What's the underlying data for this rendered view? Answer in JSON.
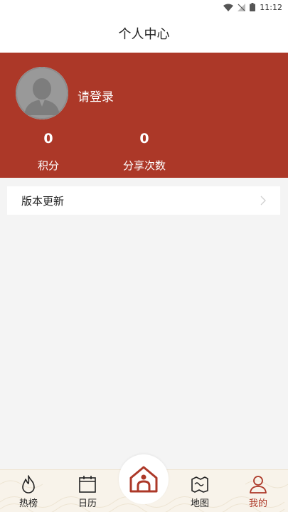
{
  "status_bar": {
    "time": "11:12"
  },
  "header": {
    "title": "个人中心"
  },
  "profile": {
    "login_prompt": "请登录",
    "stats": [
      {
        "value": "0",
        "label": "积分"
      },
      {
        "value": "0",
        "label": "分享次数"
      }
    ]
  },
  "menu": {
    "items": [
      {
        "label": "版本更新",
        "icon": "chevron-right-icon"
      }
    ]
  },
  "tabbar": {
    "items": [
      {
        "label": "热榜",
        "icon": "flame-icon"
      },
      {
        "label": "日历",
        "icon": "calendar-icon"
      },
      {
        "label": "",
        "icon": "home-icon"
      },
      {
        "label": "地图",
        "icon": "map-icon"
      },
      {
        "label": "我的",
        "icon": "user-icon"
      }
    ],
    "active_index": 4
  },
  "colors": {
    "brand": "#ac3828",
    "background": "#f4f4f4",
    "tabbar_bg": "#f8f3ea"
  }
}
